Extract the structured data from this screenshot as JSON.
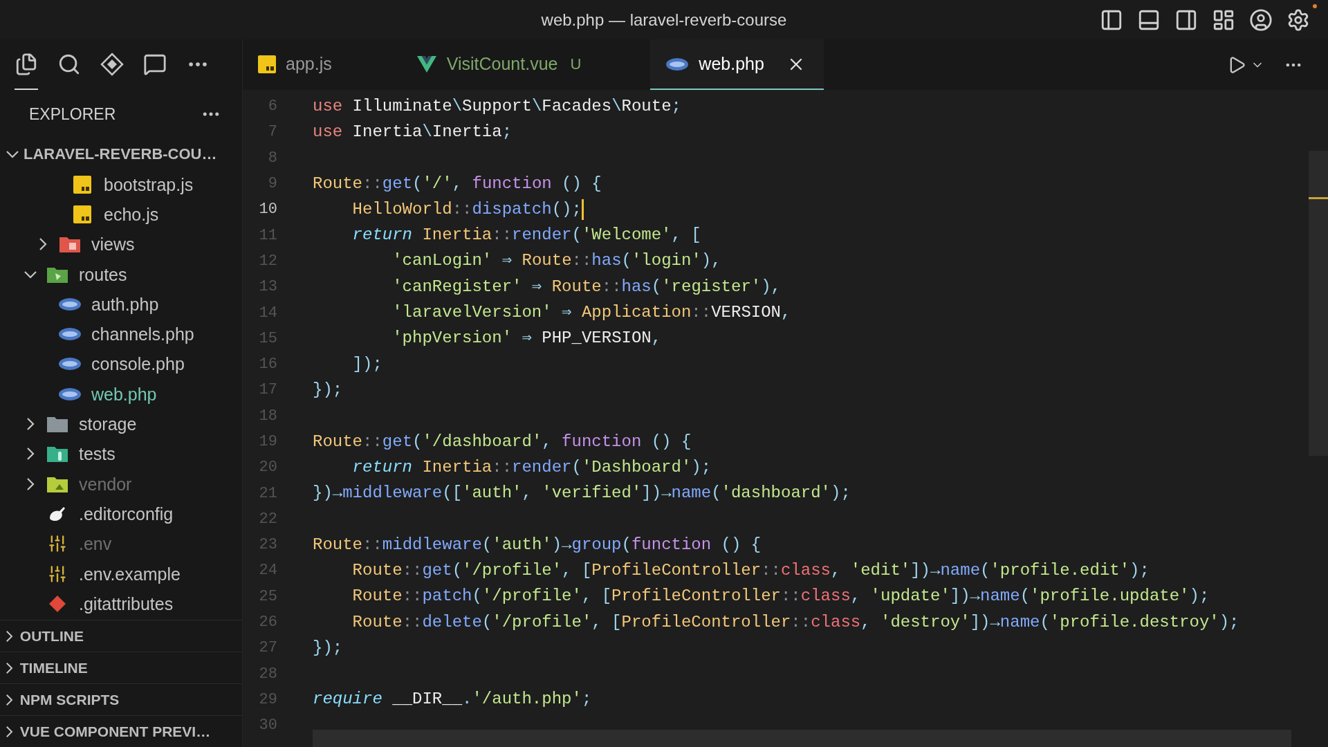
{
  "window": {
    "title": "web.php — laravel-reverb-course"
  },
  "activity_bar": [
    {
      "kind": "files",
      "selected": true
    },
    {
      "kind": "search",
      "selected": false
    },
    {
      "kind": "diamond",
      "selected": false
    },
    {
      "kind": "chat",
      "selected": false
    },
    {
      "kind": "more",
      "selected": false
    }
  ],
  "sidebar": {
    "title": "EXPLORER",
    "root": {
      "label": "LARAVEL-REVERB-COU…",
      "expanded": true
    },
    "tree": [
      {
        "children": [
          {
            "children": [
              {
                "label": "bootstrap.js",
                "kind": "js",
                "dimmed": false,
                "modified": false
              },
              {
                "label": "echo.js",
                "kind": "js",
                "dimmed": false,
                "modified": false
              }
            ]
          },
          {
            "label": "views",
            "kind": "views",
            "expanded": false,
            "dimmed": false,
            "modified": false
          }
        ]
      },
      {
        "label": "routes",
        "kind": "routes",
        "expanded": true,
        "dimmed": false,
        "modified": false,
        "children": [
          {
            "label": "auth.php",
            "kind": "php",
            "dimmed": false,
            "modified": false
          },
          {
            "label": "channels.php",
            "kind": "php",
            "dimmed": false,
            "modified": false
          },
          {
            "label": "console.php",
            "kind": "php",
            "dimmed": false,
            "modified": false
          },
          {
            "label": "web.php",
            "kind": "php",
            "dimmed": false,
            "modified": true
          }
        ]
      },
      {
        "label": "storage",
        "kind": "storage",
        "expanded": false,
        "dimmed": false,
        "modified": false
      },
      {
        "label": "tests",
        "kind": "tests",
        "expanded": false,
        "dimmed": false,
        "modified": false
      },
      {
        "label": "vendor",
        "kind": "vendor",
        "expanded": false,
        "dimmed": true,
        "modified": false
      },
      {
        "label": ".editorconfig",
        "kind": "editorconfig",
        "dimmed": false,
        "modified": false
      },
      {
        "label": ".env",
        "kind": "env",
        "dimmed": true,
        "modified": false
      },
      {
        "label": ".env.example",
        "kind": "env",
        "dimmed": false,
        "modified": false
      },
      {
        "label": ".gitattributes",
        "kind": "git",
        "dimmed": false,
        "modified": false
      }
    ],
    "panels": [
      {
        "label": "OUTLINE",
        "expanded": false
      },
      {
        "label": "TIMELINE",
        "expanded": false
      },
      {
        "label": "NPM SCRIPTS",
        "expanded": false
      },
      {
        "label": "VUE COMPONENT PREVI…",
        "expanded": false
      }
    ]
  },
  "tabs": [
    {
      "label": "app.js",
      "kind": "js",
      "selected": false,
      "untracked": false
    },
    {
      "label": "VisitCount.vue",
      "kind": "vue",
      "selected": false,
      "untracked": true,
      "badge": "U"
    },
    {
      "label": "web.php",
      "kind": "php",
      "selected": true,
      "untracked": false
    }
  ],
  "code": [
    {
      "number": "6",
      "current": false,
      "tokens": [
        {
          "kind": "keyword",
          "text": "use"
        },
        {
          "kind": "plain",
          "text": " Illuminate"
        },
        {
          "kind": "punct",
          "text": "\\"
        },
        {
          "kind": "plain",
          "text": "Support"
        },
        {
          "kind": "punct",
          "text": "\\"
        },
        {
          "kind": "plain",
          "text": "Facades"
        },
        {
          "kind": "punct",
          "text": "\\"
        },
        {
          "kind": "plain",
          "text": "Route"
        },
        {
          "kind": "punct",
          "text": ";"
        }
      ]
    },
    {
      "number": "7",
      "current": false,
      "tokens": [
        {
          "kind": "keyword",
          "text": "use"
        },
        {
          "kind": "plain",
          "text": " Inertia"
        },
        {
          "kind": "punct",
          "text": "\\"
        },
        {
          "kind": "plain",
          "text": "Inertia"
        },
        {
          "kind": "punct",
          "text": ";"
        }
      ]
    },
    {
      "number": "8",
      "current": false
    },
    {
      "number": "9",
      "current": false,
      "tokens": [
        {
          "kind": "type",
          "text": "Route"
        },
        {
          "kind": "operator",
          "text": "::"
        },
        {
          "kind": "method",
          "text": "get"
        },
        {
          "kind": "punct",
          "text": "("
        },
        {
          "kind": "string",
          "text": "'/'"
        },
        {
          "kind": "punct",
          "text": ", "
        },
        {
          "kind": "function",
          "text": "function"
        },
        {
          "kind": "punct",
          "text": " () {"
        }
      ]
    },
    {
      "number": "10",
      "current": true,
      "tokens": [
        {
          "kind": "type",
          "text": "    HelloWorld"
        },
        {
          "kind": "operator",
          "text": "::"
        },
        {
          "kind": "method",
          "text": "dispatch"
        },
        {
          "kind": "punct",
          "text": "();"
        }
      ]
    },
    {
      "number": "11",
      "current": false,
      "tokens": [
        {
          "kind": "control",
          "text": "    return"
        },
        {
          "kind": "type",
          "text": " Inertia"
        },
        {
          "kind": "operator",
          "text": "::"
        },
        {
          "kind": "method",
          "text": "render"
        },
        {
          "kind": "punct",
          "text": "("
        },
        {
          "kind": "string",
          "text": "'Welcome'"
        },
        {
          "kind": "punct",
          "text": ", ["
        }
      ]
    },
    {
      "number": "12",
      "current": false,
      "tokens": [
        {
          "kind": "string",
          "text": "        'canLogin'"
        },
        {
          "kind": "punct",
          "text": " ⇒ "
        },
        {
          "kind": "type",
          "text": "Route"
        },
        {
          "kind": "operator",
          "text": "::"
        },
        {
          "kind": "method",
          "text": "has"
        },
        {
          "kind": "punct",
          "text": "("
        },
        {
          "kind": "string",
          "text": "'login'"
        },
        {
          "kind": "punct",
          "text": "),"
        }
      ]
    },
    {
      "number": "13",
      "current": false,
      "tokens": [
        {
          "kind": "string",
          "text": "        'canRegister'"
        },
        {
          "kind": "punct",
          "text": " ⇒ "
        },
        {
          "kind": "type",
          "text": "Route"
        },
        {
          "kind": "operator",
          "text": "::"
        },
        {
          "kind": "method",
          "text": "has"
        },
        {
          "kind": "punct",
          "text": "("
        },
        {
          "kind": "string",
          "text": "'register'"
        },
        {
          "kind": "punct",
          "text": "),"
        }
      ]
    },
    {
      "number": "14",
      "current": false,
      "tokens": [
        {
          "kind": "string",
          "text": "        'laravelVersion'"
        },
        {
          "kind": "punct",
          "text": " ⇒ "
        },
        {
          "kind": "type",
          "text": "Application"
        },
        {
          "kind": "operator",
          "text": "::"
        },
        {
          "kind": "plain",
          "text": "VERSION"
        },
        {
          "kind": "punct",
          "text": ","
        }
      ]
    },
    {
      "number": "15",
      "current": false,
      "tokens": [
        {
          "kind": "string",
          "text": "        'phpVersion'"
        },
        {
          "kind": "punct",
          "text": " ⇒ "
        },
        {
          "kind": "plain",
          "text": "PHP_VERSION"
        },
        {
          "kind": "punct",
          "text": ","
        }
      ]
    },
    {
      "number": "16",
      "current": false,
      "tokens": [
        {
          "kind": "punct",
          "text": "    ]);"
        }
      ]
    },
    {
      "number": "17",
      "current": false,
      "tokens": [
        {
          "kind": "punct",
          "text": "});"
        }
      ]
    },
    {
      "number": "18",
      "current": false
    },
    {
      "number": "19",
      "current": false,
      "tokens": [
        {
          "kind": "type",
          "text": "Route"
        },
        {
          "kind": "operator",
          "text": "::"
        },
        {
          "kind": "method",
          "text": "get"
        },
        {
          "kind": "punct",
          "text": "("
        },
        {
          "kind": "string",
          "text": "'/dashboard'"
        },
        {
          "kind": "punct",
          "text": ", "
        },
        {
          "kind": "function",
          "text": "function"
        },
        {
          "kind": "punct",
          "text": " () {"
        }
      ]
    },
    {
      "number": "20",
      "current": false,
      "tokens": [
        {
          "kind": "control",
          "text": "    return"
        },
        {
          "kind": "type",
          "text": " Inertia"
        },
        {
          "kind": "operator",
          "text": "::"
        },
        {
          "kind": "method",
          "text": "render"
        },
        {
          "kind": "punct",
          "text": "("
        },
        {
          "kind": "string",
          "text": "'Dashboard'"
        },
        {
          "kind": "punct",
          "text": ");"
        }
      ]
    },
    {
      "number": "21",
      "current": false,
      "tokens": [
        {
          "kind": "punct",
          "text": "})→"
        },
        {
          "kind": "method",
          "text": "middleware"
        },
        {
          "kind": "punct",
          "text": "(["
        },
        {
          "kind": "string",
          "text": "'auth'"
        },
        {
          "kind": "punct",
          "text": ", "
        },
        {
          "kind": "string",
          "text": "'verified'"
        },
        {
          "kind": "punct",
          "text": "])→"
        },
        {
          "kind": "method",
          "text": "name"
        },
        {
          "kind": "punct",
          "text": "("
        },
        {
          "kind": "string",
          "text": "'dashboard'"
        },
        {
          "kind": "punct",
          "text": ");"
        }
      ]
    },
    {
      "number": "22",
      "current": false
    },
    {
      "number": "23",
      "current": false,
      "tokens": [
        {
          "kind": "type",
          "text": "Route"
        },
        {
          "kind": "operator",
          "text": "::"
        },
        {
          "kind": "method",
          "text": "middleware"
        },
        {
          "kind": "punct",
          "text": "("
        },
        {
          "kind": "string",
          "text": "'auth'"
        },
        {
          "kind": "punct",
          "text": ")→"
        },
        {
          "kind": "method",
          "text": "group"
        },
        {
          "kind": "punct",
          "text": "("
        },
        {
          "kind": "function",
          "text": "function"
        },
        {
          "kind": "punct",
          "text": " () {"
        }
      ]
    },
    {
      "number": "24",
      "current": false,
      "tokens": [
        {
          "kind": "type",
          "text": "    Route"
        },
        {
          "kind": "operator",
          "text": "::"
        },
        {
          "kind": "method",
          "text": "get"
        },
        {
          "kind": "punct",
          "text": "("
        },
        {
          "kind": "string",
          "text": "'/profile'"
        },
        {
          "kind": "punct",
          "text": ", ["
        },
        {
          "kind": "type",
          "text": "ProfileController"
        },
        {
          "kind": "operator",
          "text": "::"
        },
        {
          "kind": "classkw",
          "text": "class"
        },
        {
          "kind": "punct",
          "text": ", "
        },
        {
          "kind": "string",
          "text": "'edit'"
        },
        {
          "kind": "punct",
          "text": "])→"
        },
        {
          "kind": "method",
          "text": "name"
        },
        {
          "kind": "punct",
          "text": "("
        },
        {
          "kind": "string",
          "text": "'profile.edit'"
        },
        {
          "kind": "punct",
          "text": ");"
        }
      ]
    },
    {
      "number": "25",
      "current": false,
      "tokens": [
        {
          "kind": "type",
          "text": "    Route"
        },
        {
          "kind": "operator",
          "text": "::"
        },
        {
          "kind": "method",
          "text": "patch"
        },
        {
          "kind": "punct",
          "text": "("
        },
        {
          "kind": "string",
          "text": "'/profile'"
        },
        {
          "kind": "punct",
          "text": ", ["
        },
        {
          "kind": "type",
          "text": "ProfileController"
        },
        {
          "kind": "operator",
          "text": "::"
        },
        {
          "kind": "classkw",
          "text": "class"
        },
        {
          "kind": "punct",
          "text": ", "
        },
        {
          "kind": "string",
          "text": "'update'"
        },
        {
          "kind": "punct",
          "text": "])→"
        },
        {
          "kind": "method",
          "text": "name"
        },
        {
          "kind": "punct",
          "text": "("
        },
        {
          "kind": "string",
          "text": "'profile.update'"
        },
        {
          "kind": "punct",
          "text": ");"
        }
      ]
    },
    {
      "number": "26",
      "current": false,
      "tokens": [
        {
          "kind": "type",
          "text": "    Route"
        },
        {
          "kind": "operator",
          "text": "::"
        },
        {
          "kind": "method",
          "text": "delete"
        },
        {
          "kind": "punct",
          "text": "("
        },
        {
          "kind": "string",
          "text": "'/profile'"
        },
        {
          "kind": "punct",
          "text": ", ["
        },
        {
          "kind": "type",
          "text": "ProfileController"
        },
        {
          "kind": "operator",
          "text": "::"
        },
        {
          "kind": "classkw",
          "text": "class"
        },
        {
          "kind": "punct",
          "text": ", "
        },
        {
          "kind": "string",
          "text": "'destroy'"
        },
        {
          "kind": "punct",
          "text": "])→"
        },
        {
          "kind": "method",
          "text": "name"
        },
        {
          "kind": "punct",
          "text": "("
        },
        {
          "kind": "string",
          "text": "'profile.destroy'"
        },
        {
          "kind": "punct",
          "text": ");"
        }
      ]
    },
    {
      "number": "27",
      "current": false,
      "tokens": [
        {
          "kind": "punct",
          "text": "});"
        }
      ]
    },
    {
      "number": "28",
      "current": false
    },
    {
      "number": "29",
      "current": false,
      "tokens": [
        {
          "kind": "control",
          "text": "require"
        },
        {
          "kind": "plain",
          "text": " __DIR__"
        },
        {
          "kind": "punct",
          "text": "."
        },
        {
          "kind": "string",
          "text": "'/auth.php'"
        },
        {
          "kind": "punct",
          "text": ";"
        }
      ]
    },
    {
      "number": "30",
      "current": false
    }
  ]
}
